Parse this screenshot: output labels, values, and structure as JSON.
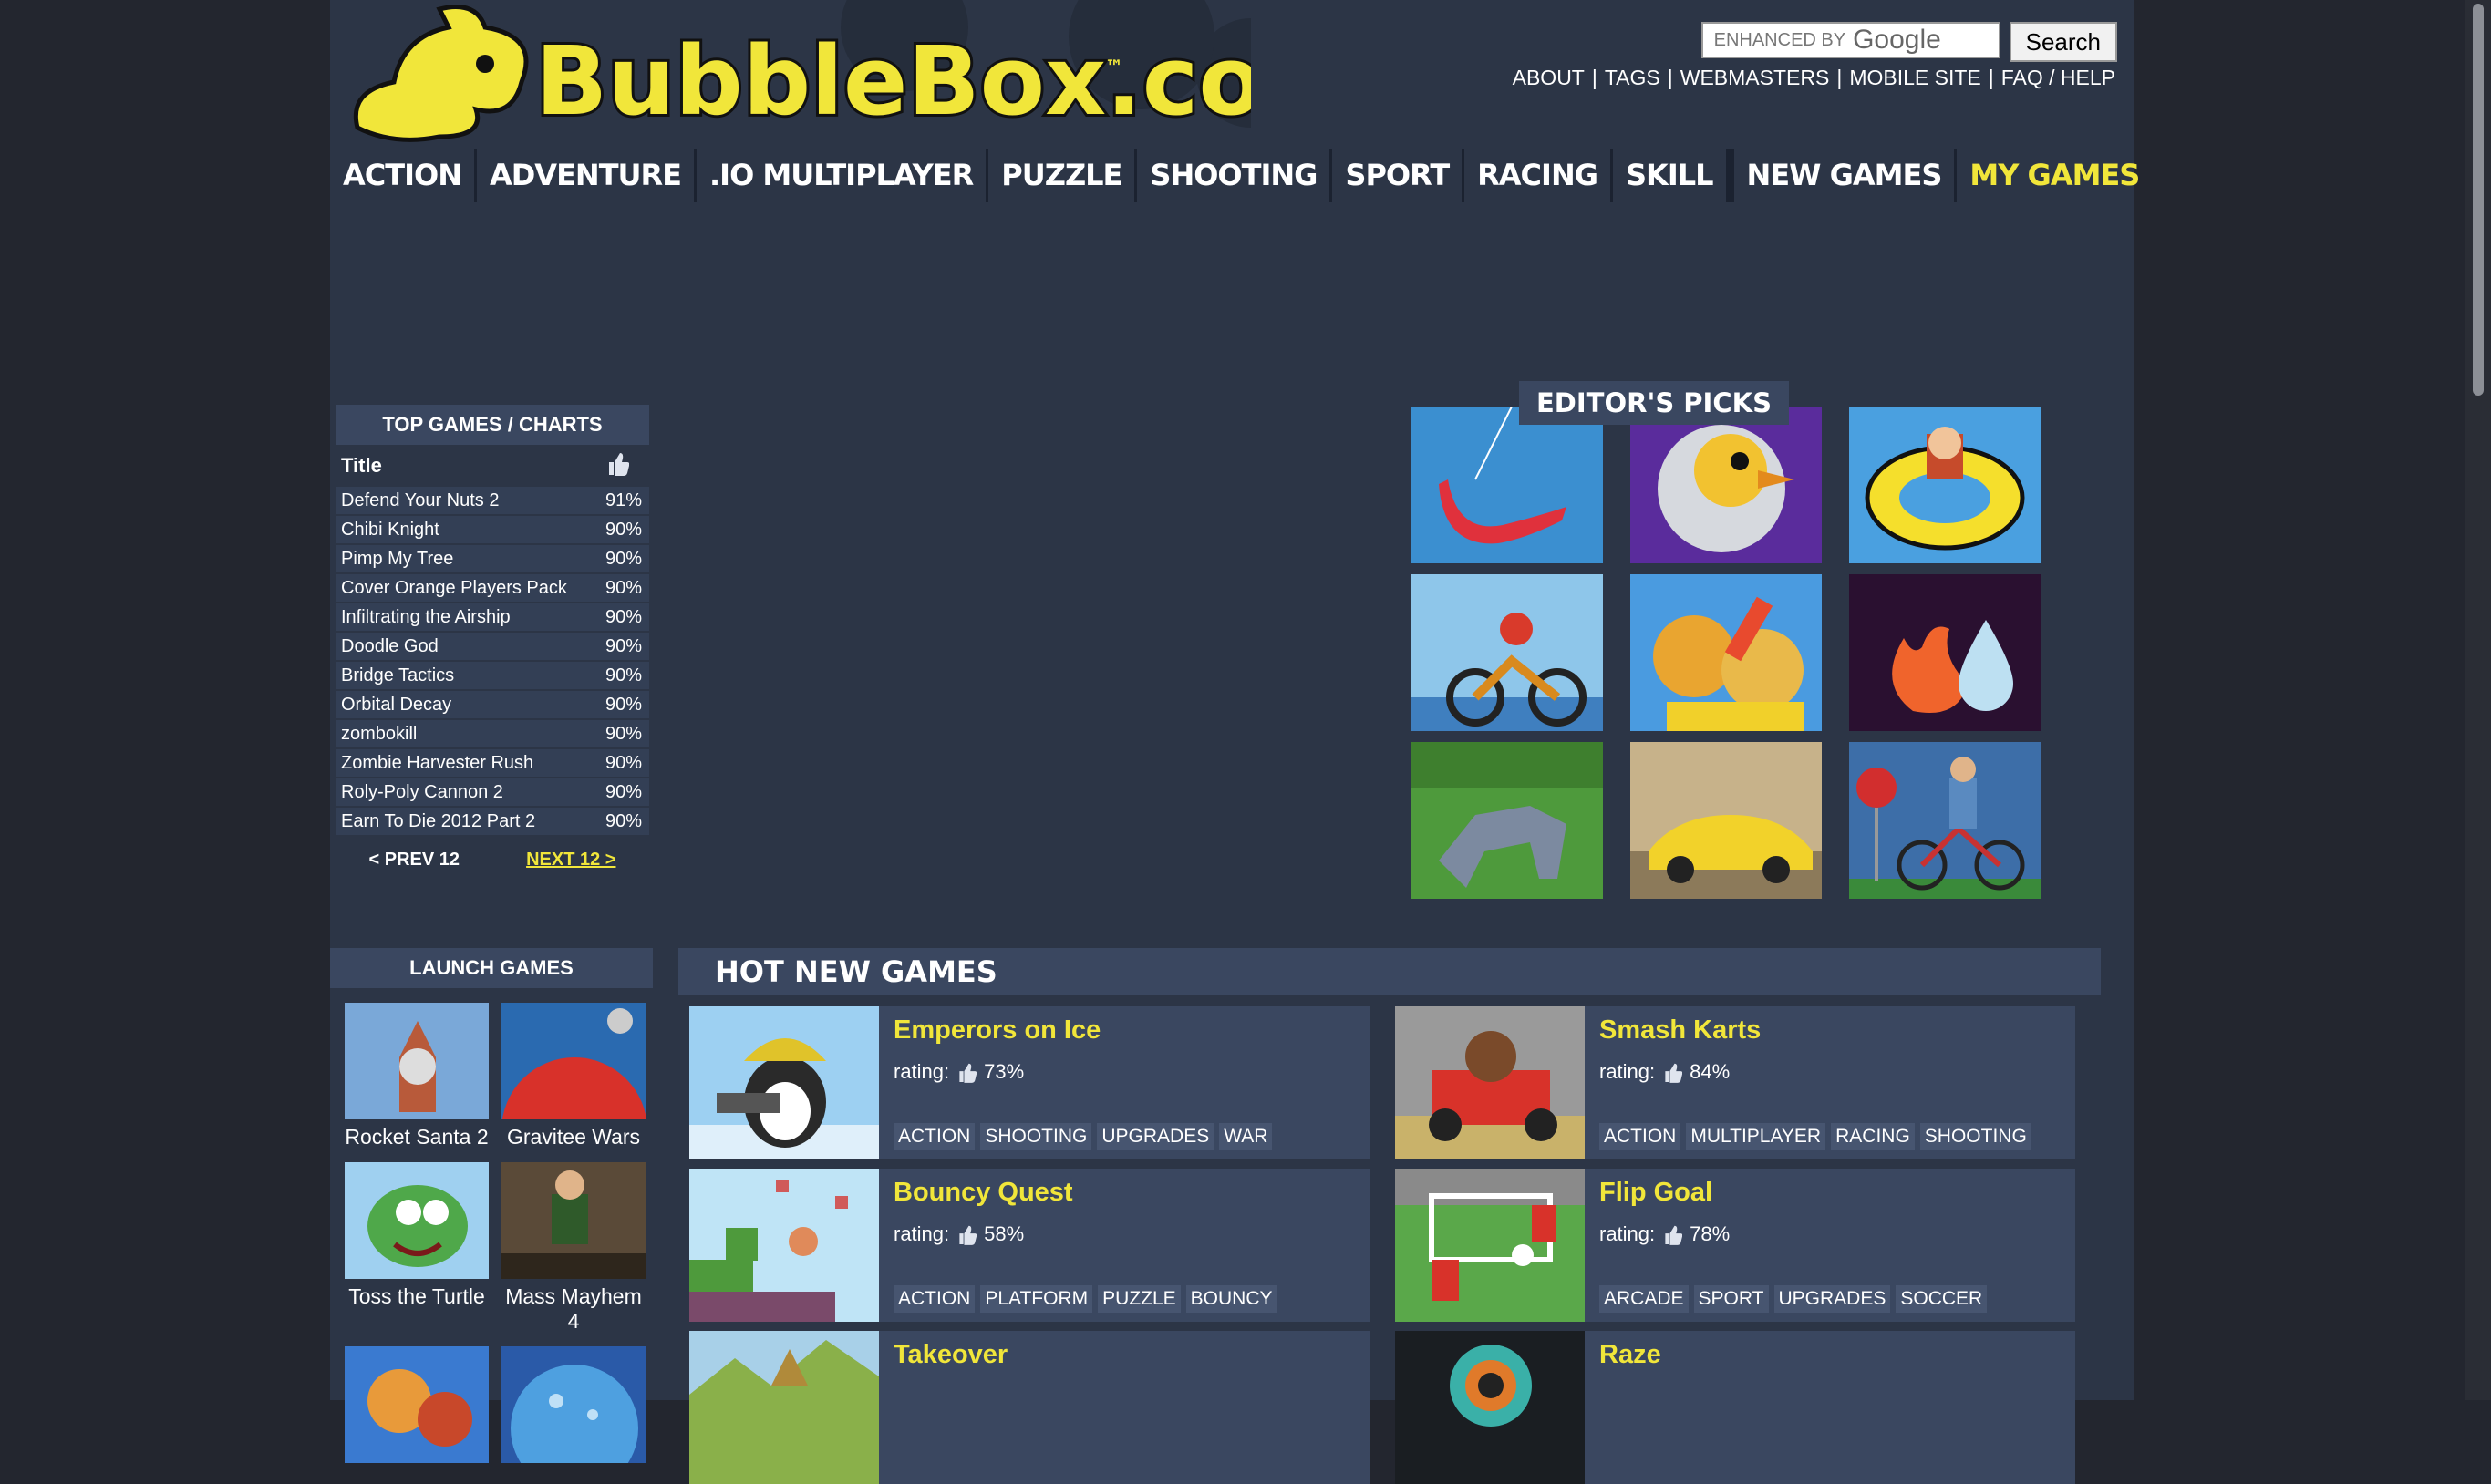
{
  "brand": {
    "name": "BubbleBox.com",
    "tm": "™"
  },
  "search": {
    "enhanced_by": "ENHANCED BY",
    "google": "Google",
    "button": "Search"
  },
  "toplinks": [
    "ABOUT",
    "TAGS",
    "WEBMASTERS",
    "MOBILE SITE",
    "FAQ / HELP"
  ],
  "nav": {
    "categories": [
      "ACTION",
      "ADVENTURE",
      ".IO MULTIPLAYER",
      "PUZZLE",
      "SHOOTING",
      "SPORT",
      "RACING",
      "SKILL"
    ],
    "new_games": "NEW GAMES",
    "my_games": "MY GAMES"
  },
  "charts": {
    "title": "TOP GAMES / CHARTS",
    "col_title": "Title",
    "rows": [
      {
        "name": "Defend Your Nuts 2",
        "pct": "91%"
      },
      {
        "name": "Chibi Knight",
        "pct": "90%"
      },
      {
        "name": "Pimp My Tree",
        "pct": "90%"
      },
      {
        "name": "Cover Orange Players Pack",
        "pct": "90%"
      },
      {
        "name": "Infiltrating the Airship",
        "pct": "90%"
      },
      {
        "name": "Doodle God",
        "pct": "90%"
      },
      {
        "name": "Bridge Tactics",
        "pct": "90%"
      },
      {
        "name": "Orbital Decay",
        "pct": "90%"
      },
      {
        "name": "zombokill",
        "pct": "90%"
      },
      {
        "name": "Zombie Harvester Rush",
        "pct": "90%"
      },
      {
        "name": "Roly-Poly Cannon 2",
        "pct": "90%"
      },
      {
        "name": "Earn To Die 2012 Part 2",
        "pct": "90%"
      }
    ],
    "prev": "< PREV 12",
    "next": "NEXT 12 >"
  },
  "editors_picks": {
    "title": "EDITOR'S PICKS"
  },
  "launch": {
    "title": "LAUNCH GAMES",
    "games": [
      "Rocket Santa 2",
      "Gravitee Wars",
      "Toss the Turtle",
      "Mass Mayhem 4"
    ]
  },
  "hot": {
    "title": "HOT NEW GAMES",
    "rating_label": "rating:",
    "games": [
      {
        "name": "Emperors on Ice",
        "rating": "73%",
        "tags": [
          "ACTION",
          "SHOOTING",
          "UPGRADES",
          "WAR"
        ]
      },
      {
        "name": "Smash Karts",
        "rating": "84%",
        "tags": [
          "ACTION",
          "MULTIPLAYER",
          "RACING",
          "SHOOTING"
        ]
      },
      {
        "name": "Bouncy Quest",
        "rating": "58%",
        "tags": [
          "ACTION",
          "PLATFORM",
          "PUZZLE",
          "BOUNCY"
        ]
      },
      {
        "name": "Flip Goal",
        "rating": "78%",
        "tags": [
          "ARCADE",
          "SPORT",
          "UPGRADES",
          "SOCCER"
        ]
      },
      {
        "name": "Takeover",
        "rating": "",
        "tags": []
      },
      {
        "name": "Raze",
        "rating": "",
        "tags": []
      }
    ]
  },
  "colors": {
    "accent": "#f1e63a",
    "page_bg": "#2c3546",
    "panel": "#3a4760"
  }
}
